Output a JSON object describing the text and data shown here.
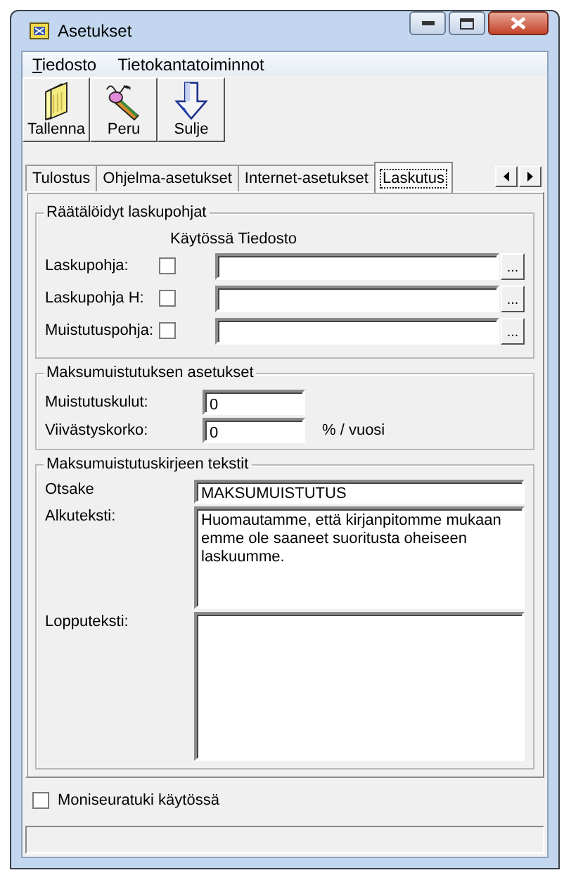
{
  "window": {
    "title": "Asetukset"
  },
  "menu": [
    {
      "label": "Tiedosto",
      "underline_first": true
    },
    {
      "label": "Tietokantatoiminnot",
      "underline_first": false
    }
  ],
  "toolbar": [
    {
      "label": "Tallenna"
    },
    {
      "label": "Peru"
    },
    {
      "label": "Sulje"
    }
  ],
  "tabs": [
    {
      "label": "Tulostus",
      "selected": false
    },
    {
      "label": "Ohjelma-asetukset",
      "selected": false
    },
    {
      "label": "Internet-asetukset",
      "selected": false
    },
    {
      "label": "Laskutus",
      "selected": true
    }
  ],
  "templates": {
    "title": "Räätälöidyt laskupohjat",
    "columns": [
      "Käytössä",
      "Tiedosto"
    ],
    "rows": [
      {
        "label": "Laskupohja:",
        "checked": false,
        "browse": "..."
      },
      {
        "label": "Laskupohja H:",
        "checked": false,
        "browse": "..."
      },
      {
        "label": "Muistutuspohja:",
        "checked": false,
        "browse": "..."
      }
    ]
  },
  "reminder_settings": {
    "title": "Maksumuistutuksen asetukset",
    "fields": [
      {
        "label": "Muistutuskulut:",
        "value": "0"
      },
      {
        "label": "Viivästyskorko:",
        "value": "0",
        "unit": "% / vuosi"
      }
    ]
  },
  "letter_texts": {
    "title": "Maksumuistutuskirjeen tekstit",
    "fields": [
      {
        "kind": "line",
        "label": "Otsake",
        "value": "MAKSUMUISTUTUS"
      },
      {
        "kind": "area",
        "label": "Alkuteksti:",
        "value": "Huomautamme, että kirjanpitomme mukaan emme ole saaneet suoritusta oheiseen laskuumme."
      },
      {
        "kind": "area",
        "label": "Lopputeksti:"
      }
    ]
  },
  "multi_company": {
    "label": "Moniseuratuki käytössä",
    "checked": false
  }
}
